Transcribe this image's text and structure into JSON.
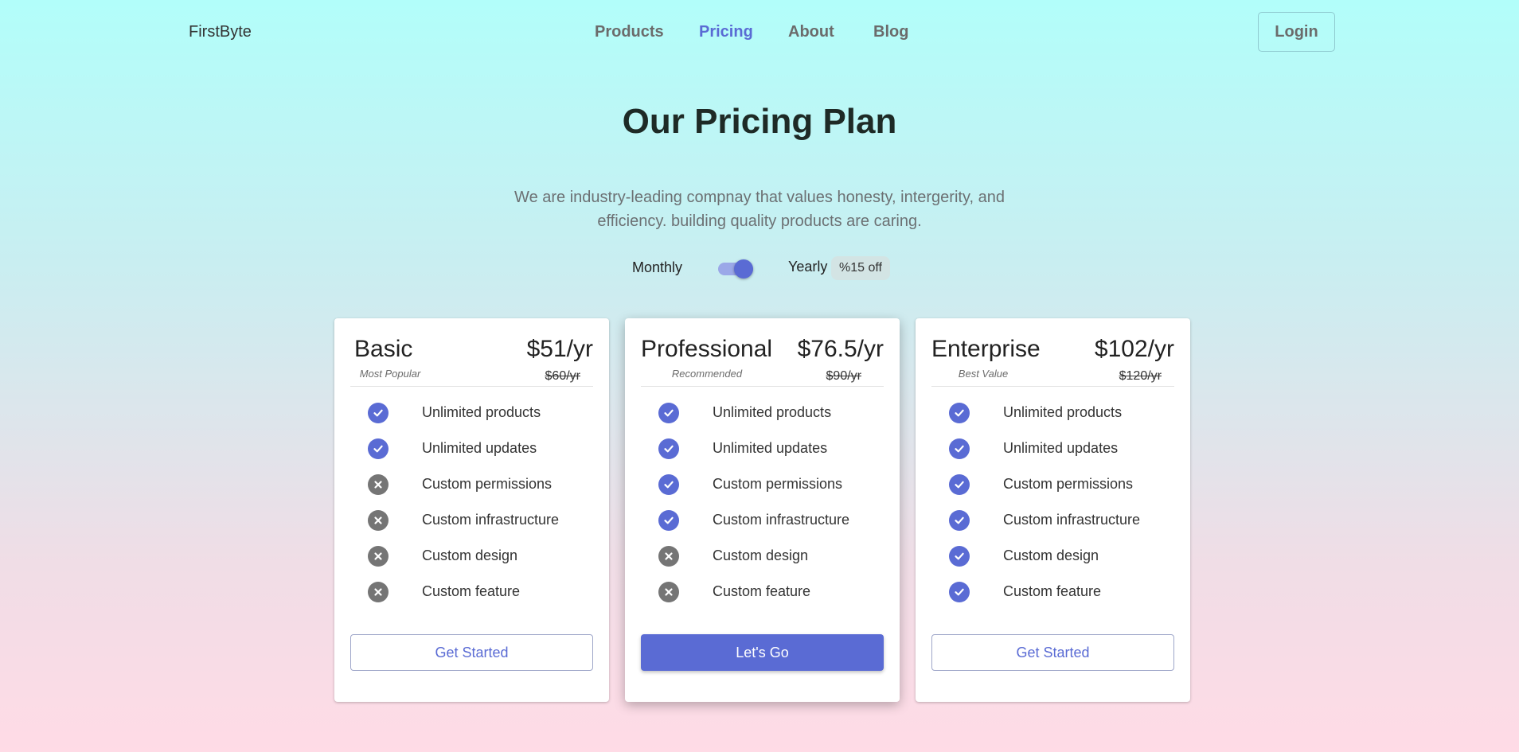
{
  "brand": "FirstByte",
  "nav": {
    "products": "Products",
    "pricing": "Pricing",
    "about": "About",
    "blog": "Blog",
    "active": "Pricing"
  },
  "login_label": "Login",
  "hero": {
    "title": "Our Pricing Plan",
    "subtitle": "We are industry-leading compnay that values honesty, intergerity, and efficiency. building quality products are caring."
  },
  "billing": {
    "monthly_label": "Monthly",
    "yearly_label": "Yearly",
    "discount": "%15 off",
    "selected": "Yearly"
  },
  "colors": {
    "accent": "#5a6bd4",
    "excluded_icon": "#757575"
  },
  "plans": [
    {
      "name": "Basic",
      "tag": "Most Popular",
      "price": "$51/yr",
      "old_price": "$60/yr",
      "cta": "Get Started",
      "features": [
        {
          "label": "Unlimited products",
          "included": true
        },
        {
          "label": "Unlimited updates",
          "included": true
        },
        {
          "label": "Custom permissions",
          "included": false
        },
        {
          "label": "Custom infrastructure",
          "included": false
        },
        {
          "label": "Custom design",
          "included": false
        },
        {
          "label": "Custom feature",
          "included": false
        }
      ]
    },
    {
      "name": "Professional",
      "tag": "Recommended",
      "price": "$76.5/yr",
      "old_price": "$90/yr",
      "cta": "Let's Go",
      "features": [
        {
          "label": "Unlimited products",
          "included": true
        },
        {
          "label": "Unlimited updates",
          "included": true
        },
        {
          "label": "Custom permissions",
          "included": true
        },
        {
          "label": "Custom infrastructure",
          "included": true
        },
        {
          "label": "Custom design",
          "included": false
        },
        {
          "label": "Custom feature",
          "included": false
        }
      ]
    },
    {
      "name": "Enterprise",
      "tag": "Best Value",
      "price": "$102/yr",
      "old_price": "$120/yr",
      "cta": "Get Started",
      "features": [
        {
          "label": "Unlimited products",
          "included": true
        },
        {
          "label": "Unlimited updates",
          "included": true
        },
        {
          "label": "Custom permissions",
          "included": true
        },
        {
          "label": "Custom infrastructure",
          "included": true
        },
        {
          "label": "Custom design",
          "included": true
        },
        {
          "label": "Custom feature",
          "included": true
        }
      ]
    }
  ]
}
